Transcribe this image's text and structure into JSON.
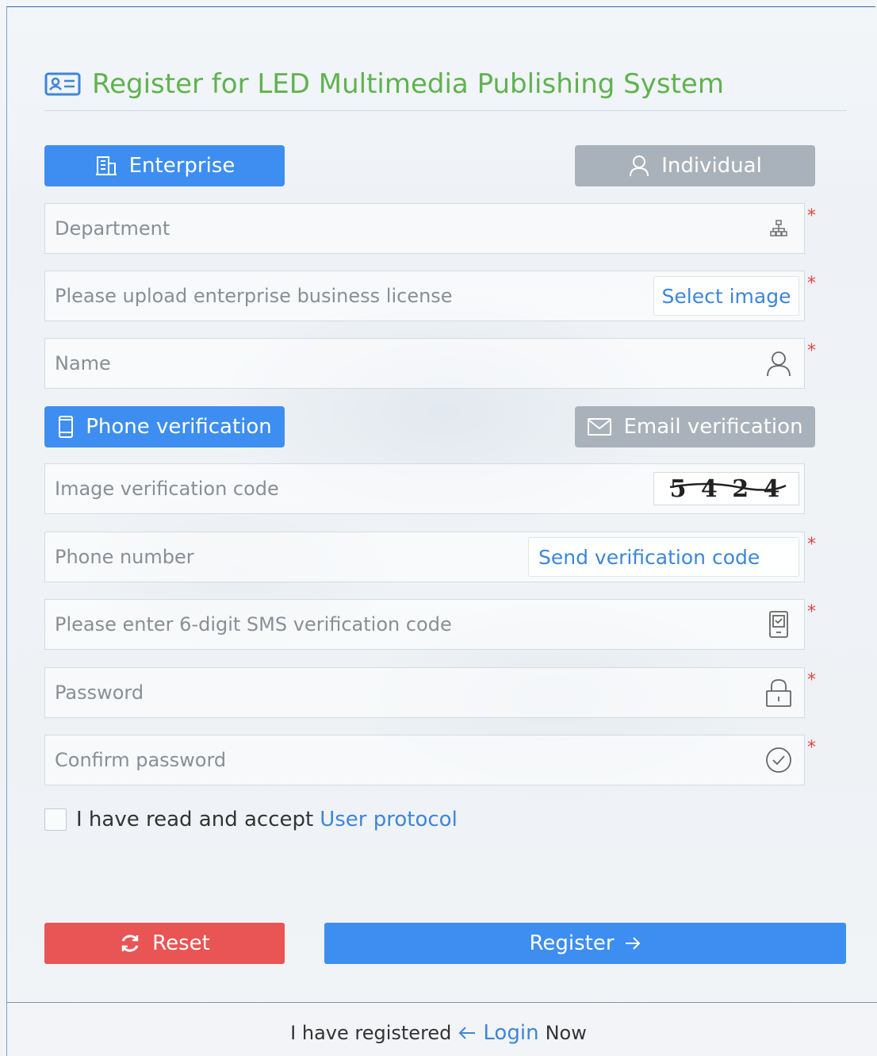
{
  "title": "Register for LED Multimedia Publishing System",
  "account_type": {
    "enterprise_label": "Enterprise",
    "individual_label": "Individual",
    "selected": "Enterprise"
  },
  "fields": {
    "department_placeholder": "Department",
    "license_placeholder": "Please upload enterprise business license",
    "license_button": "Select image",
    "name_placeholder": "Name",
    "captcha_placeholder": "Image verification code",
    "captcha_text": "5 4 2 4",
    "phone_placeholder": "Phone number",
    "send_code_button": "Send verification code",
    "sms_placeholder": "Please enter 6-digit SMS verification code",
    "password_placeholder": "Password",
    "confirm_placeholder": "Confirm password"
  },
  "verification_type": {
    "phone_label": "Phone verification",
    "email_label": "Email verification",
    "selected": "Phone verification"
  },
  "required_mark": "*",
  "agreement": {
    "text": "I have read and accept",
    "link": "User protocol",
    "checked": false
  },
  "actions": {
    "reset_label": "Reset",
    "register_label": "Register"
  },
  "footer": {
    "prefix": "I have registered",
    "login_link": "Login",
    "suffix": "Now"
  },
  "colors": {
    "title_green": "#5fb34e",
    "primary_blue": "#3d8ef0",
    "inactive_grey": "#a9b2ba",
    "reset_red": "#e95454",
    "link_blue": "#3d86d9",
    "required_red": "#e4443f"
  },
  "icons": {
    "title": "id-card-icon",
    "enterprise": "building-icon",
    "individual": "user-icon",
    "department": "sitemap-icon",
    "name": "user-icon",
    "phone_tab": "mobile-icon",
    "email_tab": "envelope-icon",
    "sms": "mobile-message-icon",
    "password": "lock-icon",
    "confirm": "check-circle-icon",
    "reset": "refresh-icon",
    "register": "arrow-right-icon",
    "footer": "arrow-left-icon"
  }
}
